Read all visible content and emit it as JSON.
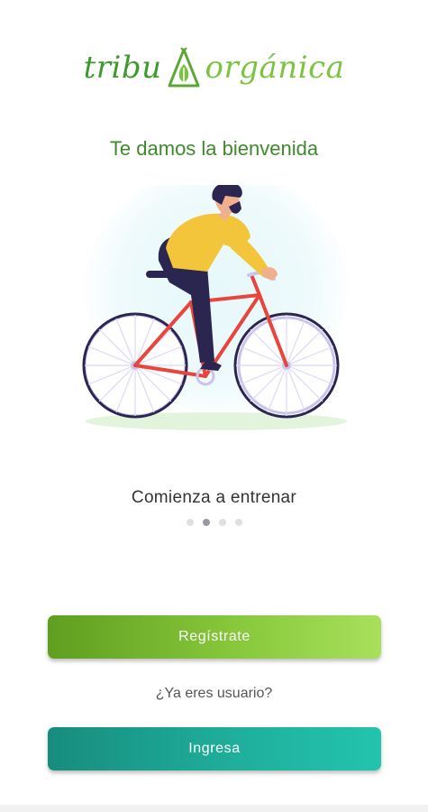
{
  "logo": {
    "part1": "tribu",
    "part2": "orgánica"
  },
  "welcome_title": "Te damos la bienvenida",
  "slide": {
    "caption": "Comienza a entrenar",
    "page_count": 4,
    "active_page": 2
  },
  "buttons": {
    "register_label": "Regístrate",
    "login_label": "Ingresa"
  },
  "already_user_text": "¿Ya eres usuario?",
  "colors": {
    "brand_green": "#5aa832",
    "register_gradient_start": "#5f9e1f",
    "register_gradient_end": "#a8e05c",
    "login_gradient_start": "#178c7e",
    "login_gradient_end": "#22c4ae"
  }
}
